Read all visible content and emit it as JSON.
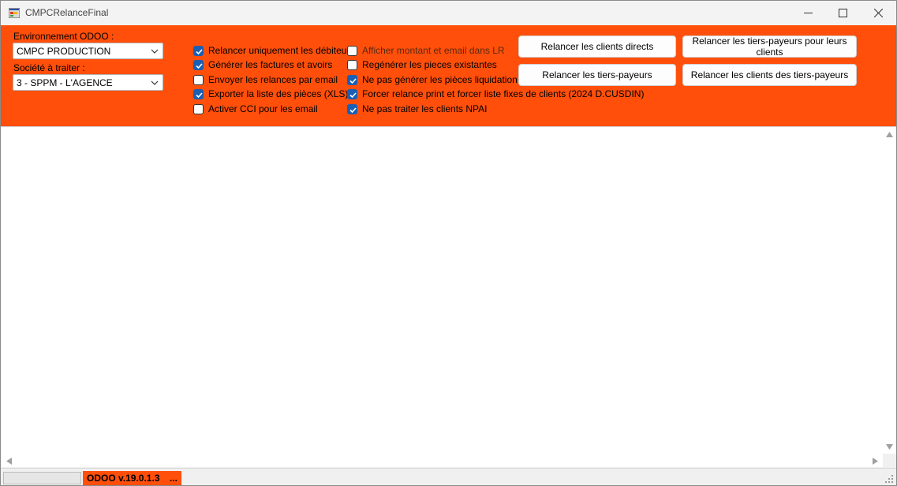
{
  "window": {
    "title": "CMPCRelanceFinal"
  },
  "config": {
    "env_label": "Environnement ODOO :",
    "env_value": "CMPC PRODUCTION",
    "company_label": "Société à traiter :",
    "company_value": "3 - SPPM - L'AGENCE"
  },
  "options_col1": [
    {
      "label": "Relancer uniquement les débiteurs",
      "checked": true
    },
    {
      "label": "Générer les factures et avoirs",
      "checked": true
    },
    {
      "label": "Envoyer les relances par email",
      "checked": false
    },
    {
      "label": "Exporter la liste des pièces (XLS)",
      "checked": true
    },
    {
      "label": "Activer CCI pour les email",
      "checked": false
    }
  ],
  "options_col2": [
    {
      "label": "Afficher montant et email dans LR",
      "checked": false
    },
    {
      "label": "Regénérer les pieces existantes",
      "checked": false
    },
    {
      "label": "Ne pas générer les pièces liquidation",
      "checked": true
    },
    {
      "label": "Forcer relance print et forcer liste fixes de clients (2024 D.CUSDIN)",
      "checked": true
    },
    {
      "label": "Ne pas traiter les clients NPAI",
      "checked": true
    }
  ],
  "buttons": {
    "direct_clients": "Relancer les clients directs",
    "third_party_for_clients": "Relancer les tiers-payeurs pour leurs clients",
    "third_party": "Relancer les tiers-payeurs",
    "clients_of_third_party": "Relancer les clients des tiers-payeurs"
  },
  "status": {
    "version": "ODOO v.19.0.1.3  |",
    "extra": "...",
    "progress": 0
  },
  "colors": {
    "accent": "#ff4f0b",
    "checkbox": "#1a5fb4"
  }
}
